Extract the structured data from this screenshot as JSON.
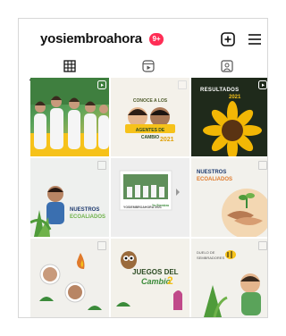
{
  "profile": {
    "username": "yosiembroahora",
    "notification_badge": "9+"
  },
  "tabs": [
    {
      "name": "grid-tab"
    },
    {
      "name": "reels-tab"
    },
    {
      "name": "tagged-tab"
    }
  ],
  "posts": [
    {
      "label": ""
    },
    {
      "top_text": "CONOCE A LOS",
      "banner": "AGENTES DE CAMBIO",
      "year": "2021"
    },
    {
      "label": "RESULTADOS",
      "year": "2021"
    },
    {
      "title_line1": "NUESTROS",
      "title_line2": "ECOALIADOS"
    },
    {
      "caption": "YOSIEMBROAHORA 2021"
    },
    {
      "title_line1": "NUESTROS",
      "title_line2": "ECOALIADOS"
    },
    {
      "label": ""
    },
    {
      "title_line1": "JUEGOS DEL",
      "title_line2": "Cambio",
      "number": "2"
    },
    {
      "small_line1": "DUELO DE",
      "small_line2": "SEMBRADORES"
    }
  ],
  "colors": {
    "badge": "#ff2d55",
    "accent_yellow": "#f6c21a",
    "accent_green": "#3b8b3a",
    "accent_orange": "#e07a2b"
  }
}
